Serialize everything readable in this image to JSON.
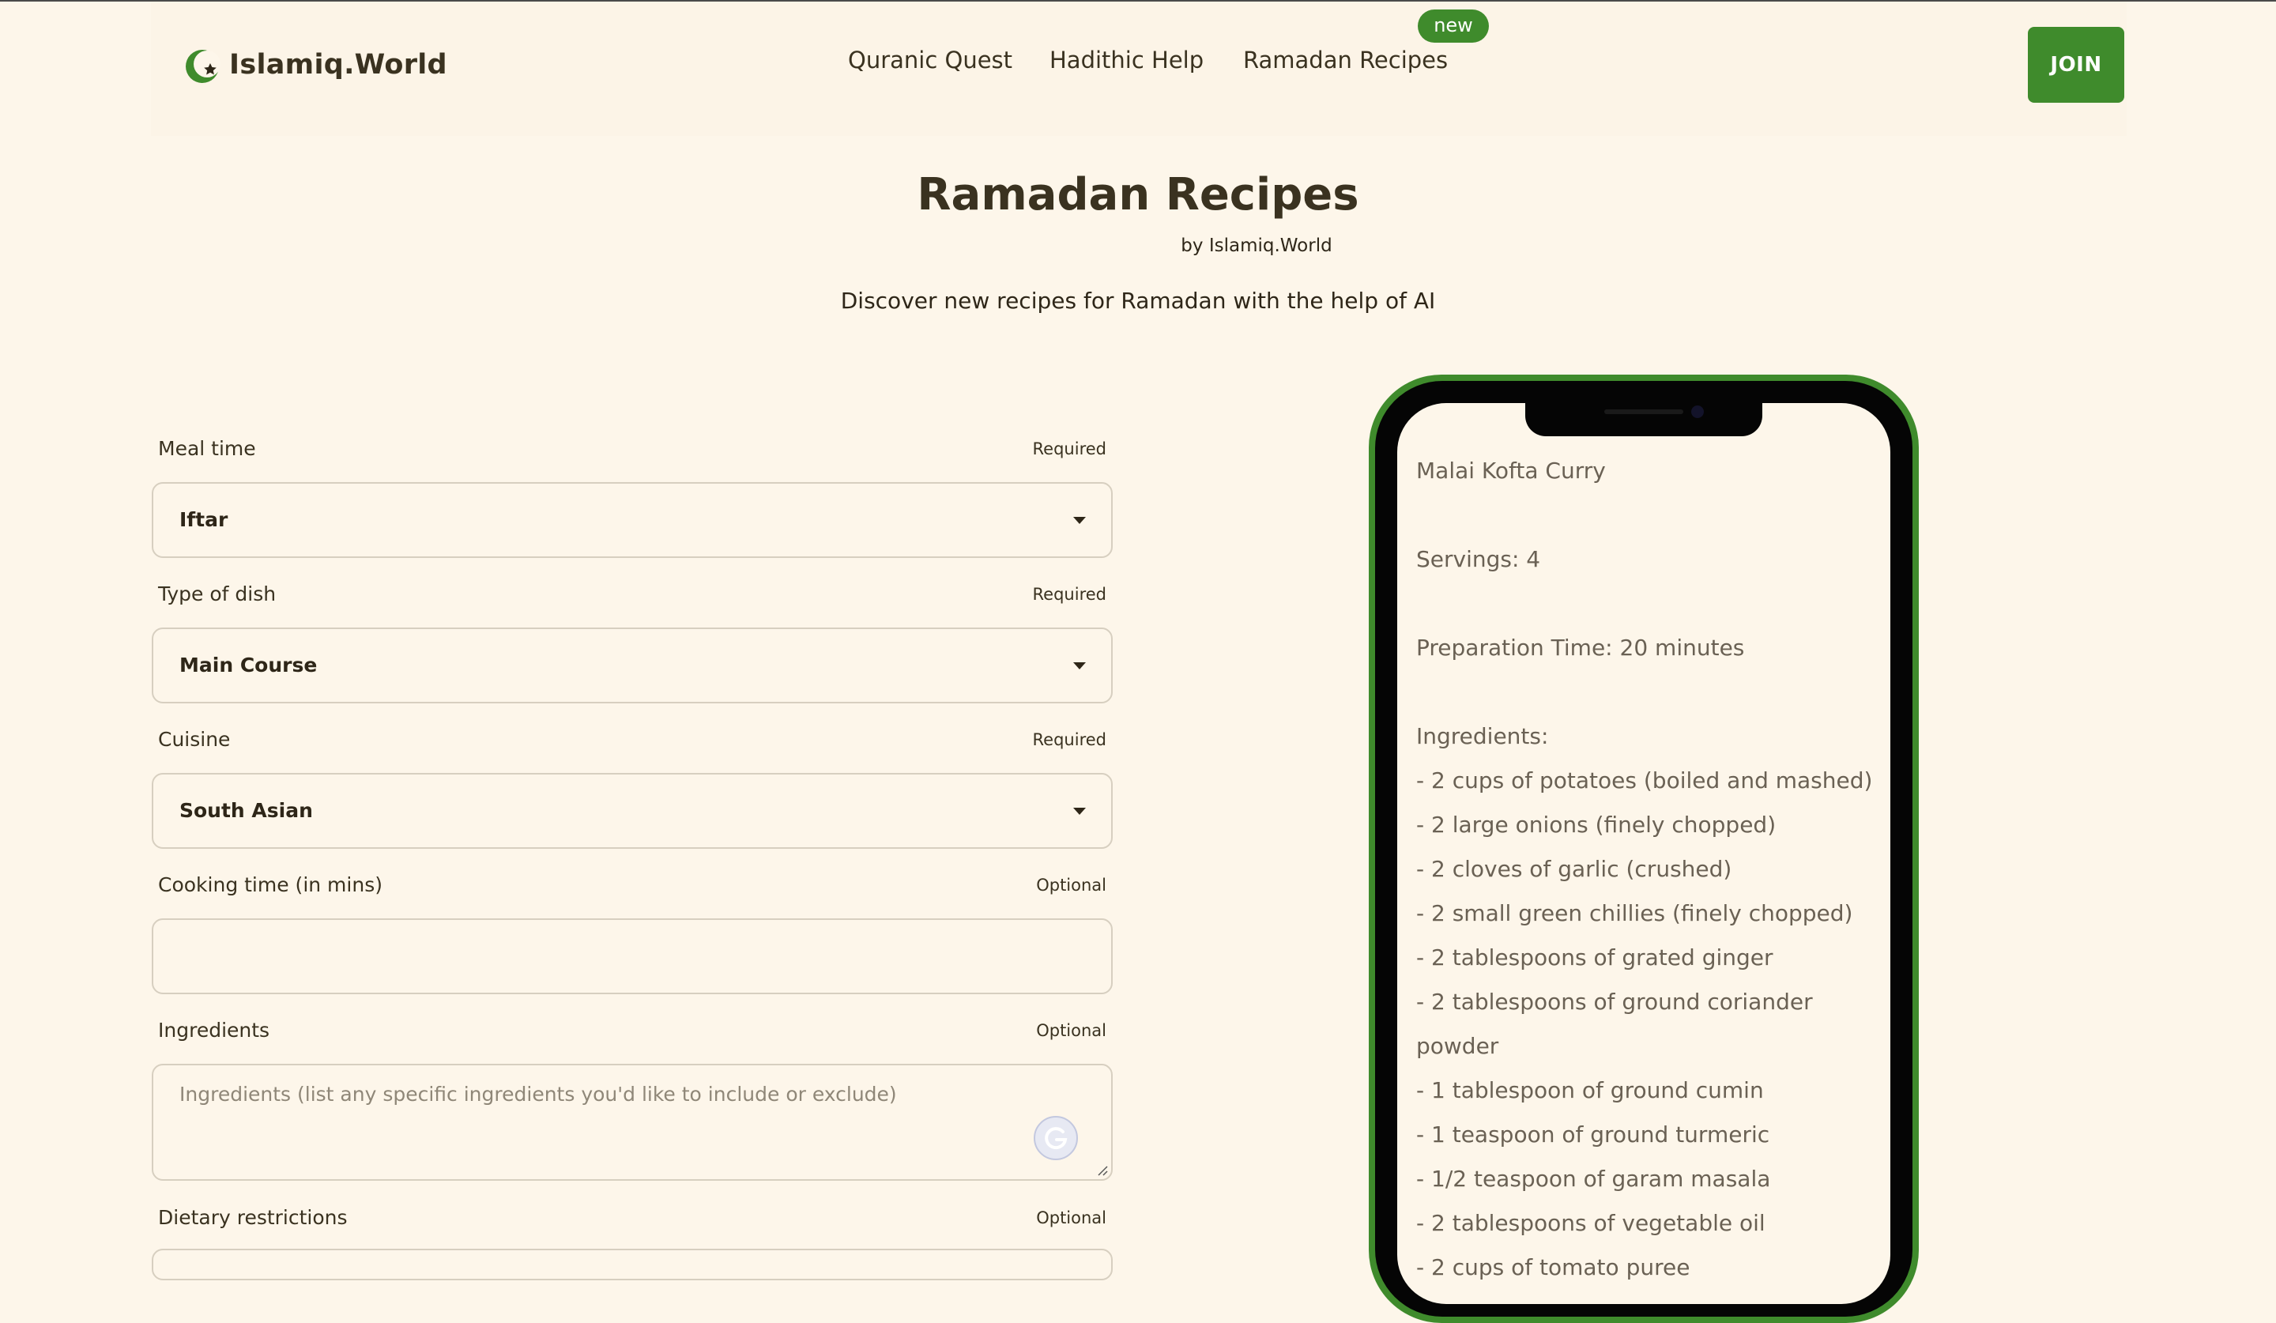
{
  "nav": {
    "brand": "Islamiq.World",
    "links": [
      {
        "label": "Quranic Quest"
      },
      {
        "label": "Hadithic Help"
      },
      {
        "label": "Ramadan Recipes"
      }
    ],
    "badge": "new",
    "join": "JOIN"
  },
  "hero": {
    "title": "Ramadan Recipes",
    "by": "by Islamiq.World",
    "subtitle": "Discover new recipes for Ramadan with the help of AI"
  },
  "form": {
    "meal_time": {
      "label": "Meal time",
      "req": "Required",
      "value": "Iftar"
    },
    "dish_type": {
      "label": "Type of dish",
      "req": "Required",
      "value": "Main Course"
    },
    "cuisine": {
      "label": "Cuisine",
      "req": "Required",
      "value": "South Asian"
    },
    "cooking_time": {
      "label": "Cooking time (in mins)",
      "req": "Optional",
      "value": ""
    },
    "ingredients": {
      "label": "Ingredients",
      "req": "Optional",
      "placeholder": "Ingredients (list any specific ingredients you'd like to include or exclude)"
    },
    "dietary": {
      "label": "Dietary restrictions",
      "req": "Optional"
    }
  },
  "recipe": {
    "name": "Malai Kofta Curry",
    "servings": "Servings: 4",
    "prep_time": "Preparation Time: 20 minutes",
    "ingredients_heading": "Ingredients:",
    "ingredients": [
      "- 2 cups of potatoes (boiled and mashed)",
      "- 2 large onions (finely chopped)",
      "- 2 cloves of garlic (crushed)",
      "- 2 small green chillies (finely chopped)",
      "- 2 tablespoons of grated ginger",
      "- 2 tablespoons of ground coriander",
      "powder",
      "- 1 tablespoon of ground cumin",
      "- 1 teaspoon of ground turmeric",
      "- 1/2 teaspoon of garam masala",
      "- 2 tablespoons of vegetable oil",
      "- 2 cups of tomato puree"
    ]
  },
  "colors": {
    "accent": "#3f8b2c",
    "background": "#fdf6ea",
    "text": "#3a3220"
  }
}
